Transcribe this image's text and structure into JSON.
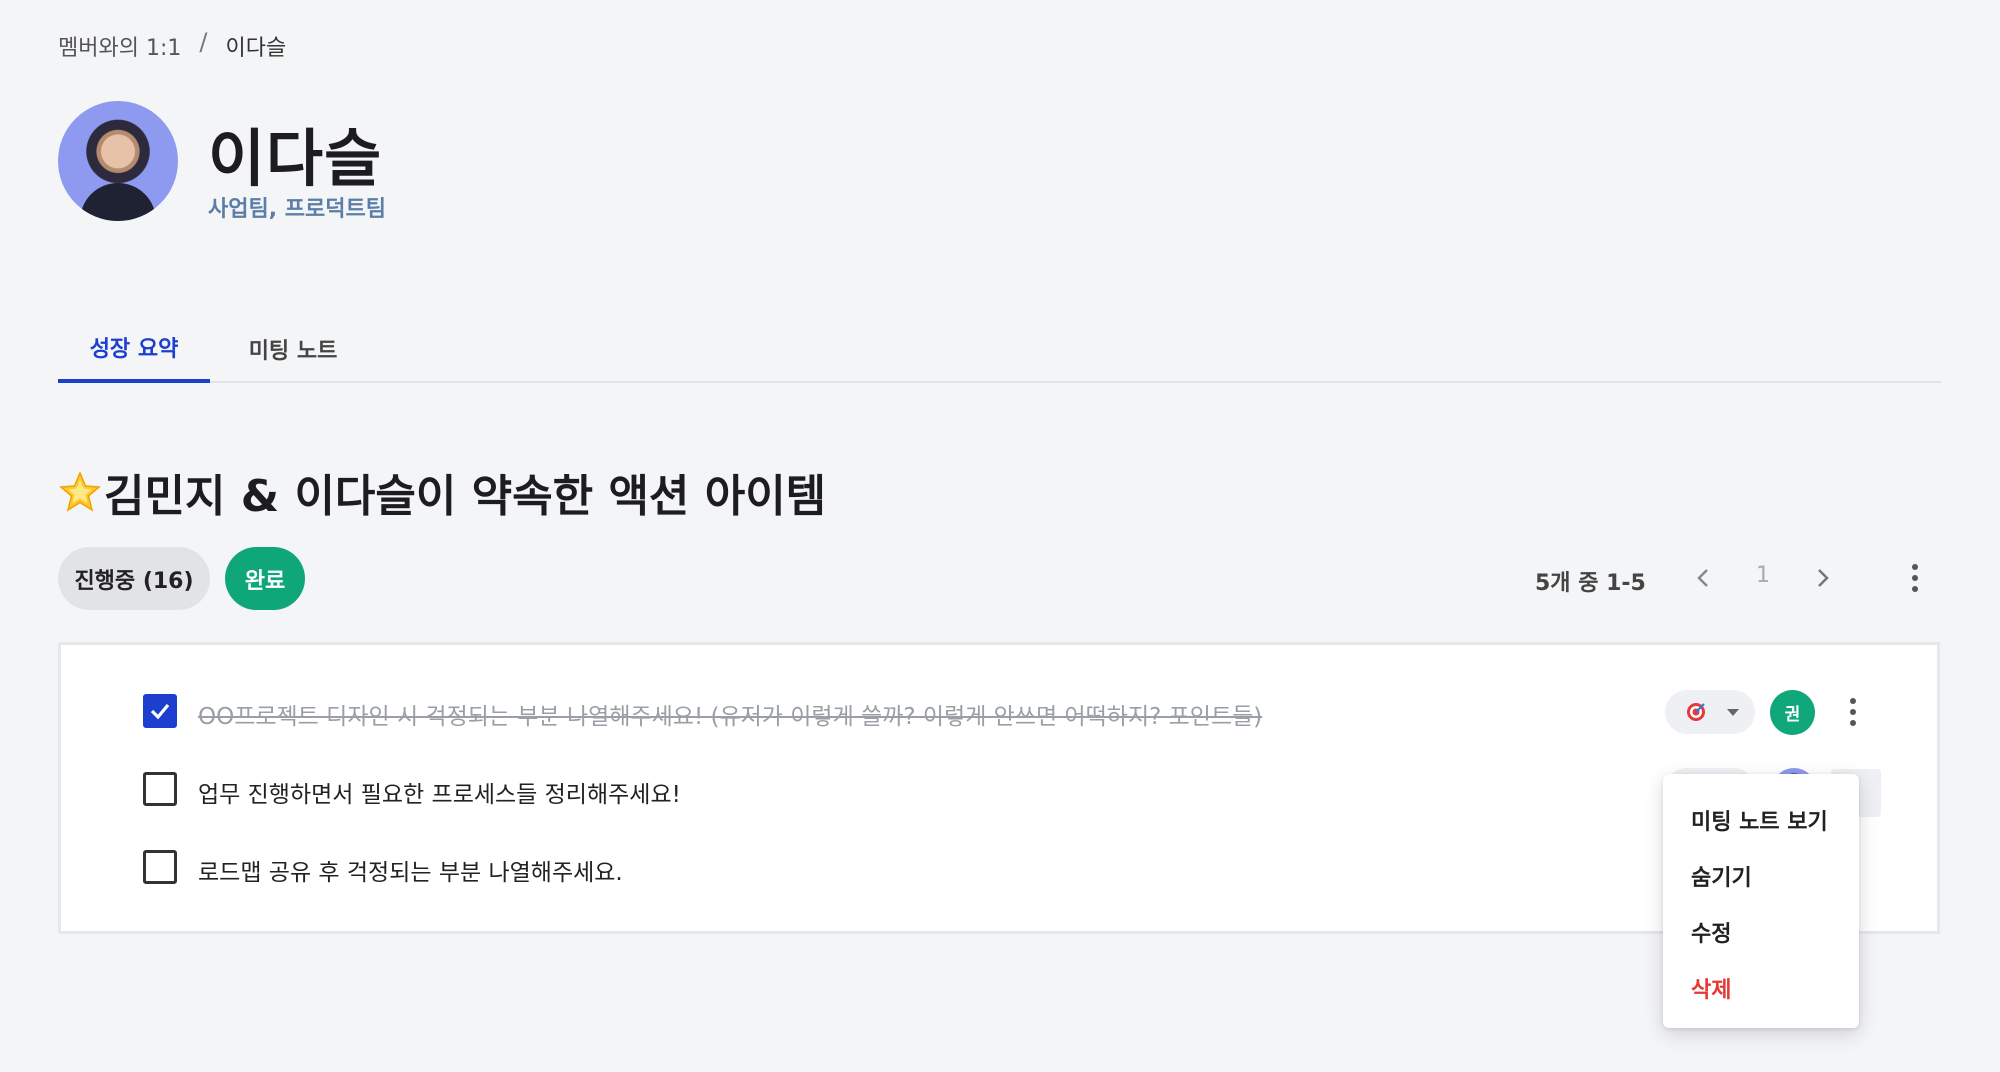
{
  "breadcrumb": {
    "parent": "멤버와의 1:1",
    "separator": "/",
    "current": "이다슬"
  },
  "profile": {
    "name": "이다슬",
    "team": "사업팀, 프로덕트팀"
  },
  "tabs": [
    {
      "label": "성장 요약",
      "active": true
    },
    {
      "label": "미팅 노트",
      "active": false
    }
  ],
  "section": {
    "title": "김민지 & 이다슬이 약속한 액션 아이템",
    "title_icon": "star-icon",
    "filters": {
      "in_progress": "진행중 (16)",
      "done": "완료"
    },
    "pager": {
      "info": "5개 중 1-5",
      "page": "1"
    }
  },
  "items": [
    {
      "text": "OO프로젝트 디자인 시 걱정되는 부분 나열해주세요! (유저가 이렇게 쓸까? 이렇게 안쓰면 어떡하지? 포인트들)",
      "checked": true,
      "assignee_initial": "권"
    },
    {
      "text": "업무 진행하면서 필요한 프로세스들 정리해주세요!",
      "checked": false
    },
    {
      "text": "로드맵 공유 후 걱정되는 부분 나열해주세요.",
      "checked": false
    }
  ],
  "menu": {
    "items": [
      "미팅 노트 보기",
      "숨기기",
      "수정",
      "삭제"
    ]
  },
  "colors": {
    "accent": "#1d3fd0",
    "success": "#0fa77a",
    "danger": "#e53935",
    "team_text": "#5a7ea8"
  }
}
